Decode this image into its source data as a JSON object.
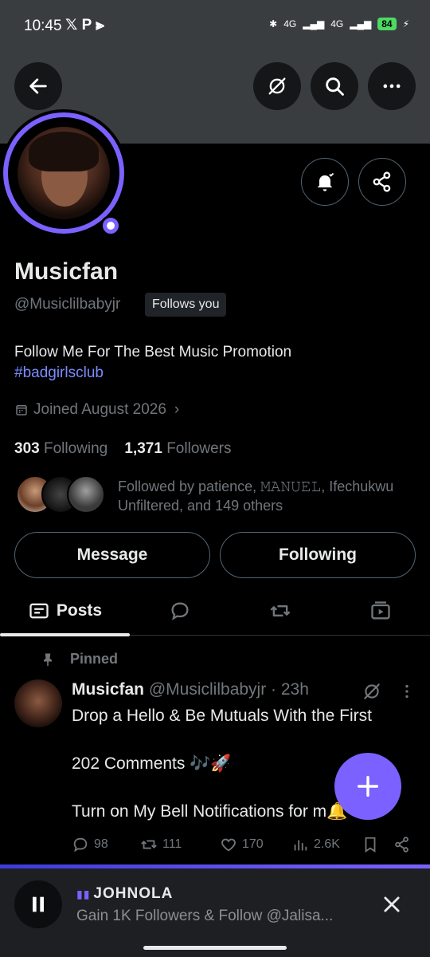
{
  "status_bar": {
    "time": "10:45",
    "left_icons": "𝕏 P ⫸",
    "battery": "84",
    "net1": "4G",
    "net2": "4G"
  },
  "profile": {
    "name": "Musicfan",
    "handle": "@Musiclilbabyjr",
    "follows_you": "Follows you",
    "bio_line": "Follow Me For The Best Music Promotion",
    "bio_tag": "#badgirlsclub",
    "joined": "Joined August 2026",
    "following_count": "303",
    "following_label": "Following",
    "followers_count": "1,371",
    "followers_label": "Followers",
    "followed_by": "Followed by patience, 𝙼𝙰𝙽𝚄𝙴𝙻, Ifechukwu Unfiltered, and 149 others"
  },
  "buttons": {
    "message": "Message",
    "following": "Following"
  },
  "tabs": {
    "posts": "Posts"
  },
  "post": {
    "pinned_label": "Pinned",
    "author": "Musicfan",
    "meta": "@Musiclilbabyjr · 23h",
    "text": "Drop a Hello & Be Mutuals With the First\n\n 202 Comments 🎶🚀\n\nTurn on My Bell Notifications for m🔔",
    "replies": "98",
    "reposts": "111",
    "likes": "170",
    "views": "2.6K"
  },
  "player": {
    "title": "JOHNOLA",
    "subtitle": "Gain 1K Followers & Follow @Jalisa..."
  },
  "colors": {
    "accent": "#7b61ff",
    "muted": "#71767b",
    "text": "#e7e9ea"
  }
}
